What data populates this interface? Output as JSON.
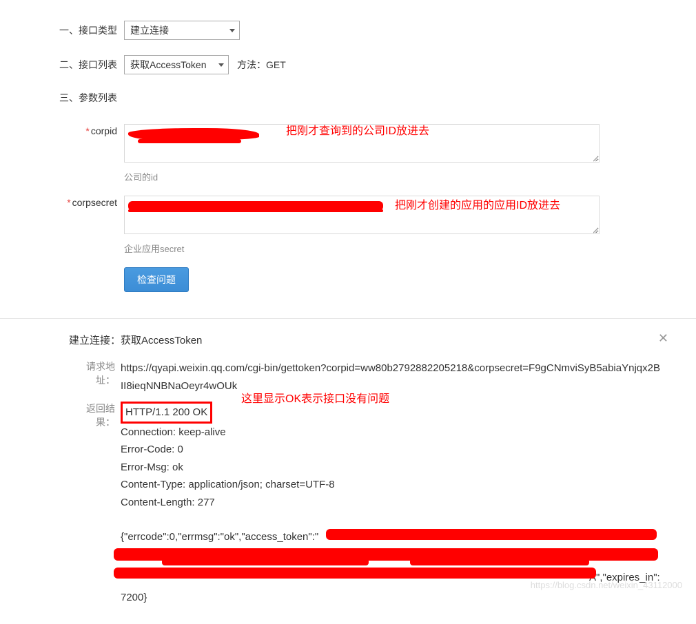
{
  "form": {
    "row1_label": "一、接口类型",
    "row1_select": "建立连接",
    "row2_label": "二、接口列表",
    "row2_select": "获取AccessToken",
    "row2_method": "方法：GET",
    "row3_label": "三、参数列表",
    "corpid_label": "corpid",
    "corpid_hint": "公司的id",
    "corpsecret_label": "corpsecret",
    "corpsecret_hint": "企业应用secret",
    "submit_btn": "检查问题"
  },
  "annotations": {
    "corpid_note": "把刚才查询到的公司ID放进去",
    "corpsecret_note": "把刚才创建的应用的应用ID放进去",
    "ok_note": "这里显示OK表示接口没有问题"
  },
  "result": {
    "title": "建立连接：获取AccessToken",
    "request_label": "请求地址：",
    "request_url": "https://qyapi.weixin.qq.com/cgi-bin/gettoken?corpid=ww80b2792882205218&corpsecret=F9gCNmviSyB5abiaYnjqx2BII8ieqNNBNaOeyr4wOUk",
    "return_label": "返回结果：",
    "http_line": "HTTP/1.1 200 OK",
    "conn_line": "Connection: keep-alive",
    "errcode_line": "Error-Code: 0",
    "errmsg_line": "Error-Msg: ok",
    "ctype_line": "Content-Type: application/json; charset=UTF-8",
    "clen_line": "Content-Length: 277",
    "json_prefix": "{\"errcode\":0,\"errmsg\":\"ok\",\"access_token\":\"",
    "json_suffix": "A\",\"expires_in\":7200}"
  },
  "colors": {
    "accent": "#3c8dd6",
    "required": "#e64340",
    "annot": "#ff0000"
  },
  "watermark": "https://blog.csdn.net/weixin_43112000"
}
